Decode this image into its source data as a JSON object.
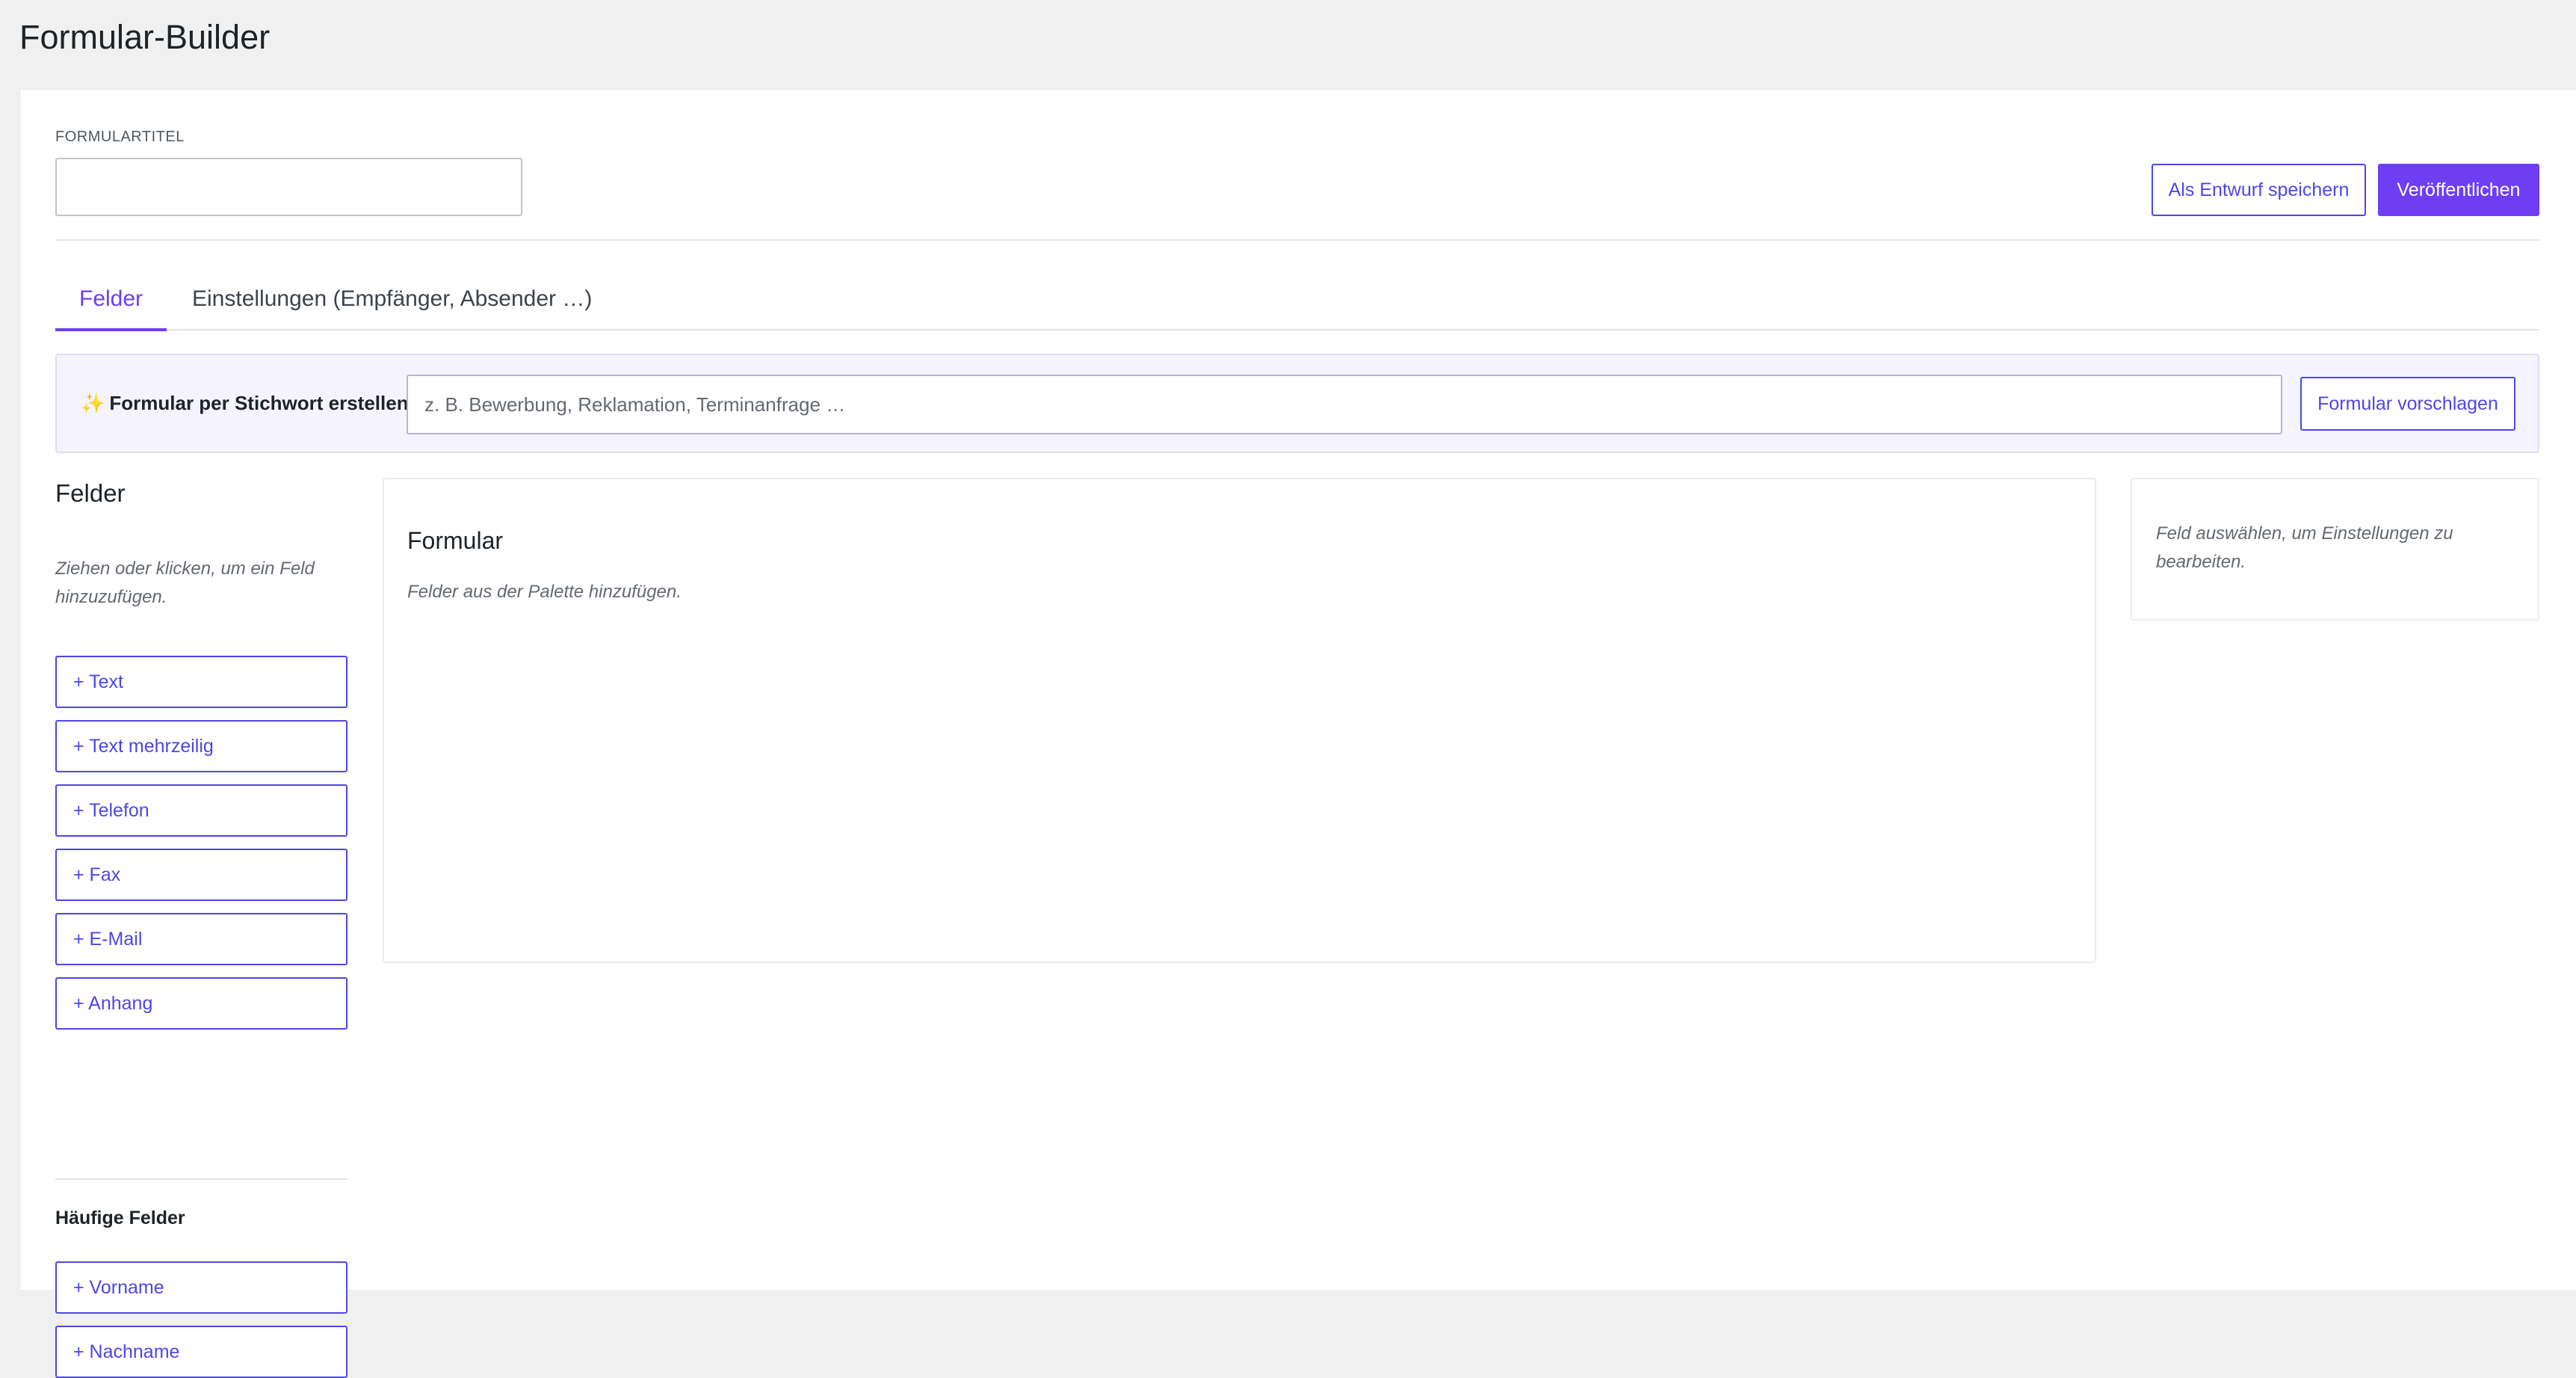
{
  "page": {
    "title": "Formular-Builder"
  },
  "header": {
    "title_label": "FORMULARTITEL",
    "title_value": "",
    "title_placeholder": "",
    "draft_button": "Als Entwurf speichern",
    "publish_button": "Veröffentlichen"
  },
  "tabs": [
    {
      "label": "Felder",
      "active": true
    },
    {
      "label": "Einstellungen (Empfänger, Absender …)",
      "active": false
    }
  ],
  "ai_bar": {
    "icon": "sparkles-icon",
    "spark_glyph": "✨",
    "label": "Formular per Stichwort erstellen:",
    "input_value": "",
    "input_placeholder": "z. B. Bewerbung, Reklamation, Terminanfrage …",
    "suggest_button": "Formular vorschlagen"
  },
  "palette": {
    "heading": "Felder",
    "hint": "Ziehen oder klicken, um ein Feld hinzuzufügen.",
    "fields": [
      {
        "label": "+ Text"
      },
      {
        "label": "+ Text mehrzeilig"
      },
      {
        "label": "+ Telefon"
      },
      {
        "label": "+ Fax"
      },
      {
        "label": "+ E-Mail"
      },
      {
        "label": "+ Anhang"
      }
    ],
    "common_heading": "Häufige Felder",
    "common_fields": [
      {
        "label": "+ Vorname"
      },
      {
        "label": "+ Nachname"
      }
    ]
  },
  "canvas": {
    "title": "Formular",
    "hint": "Felder aus der Palette hinzufügen."
  },
  "inspector": {
    "hint": "Feld auswählen, um Einstellungen zu bearbeiten."
  },
  "colors": {
    "accent": "#6d3ef2",
    "button_outline": "#4f46e5",
    "ai_bar_bg": "#f5f3fe",
    "page_bg": "#f0f0f1"
  }
}
